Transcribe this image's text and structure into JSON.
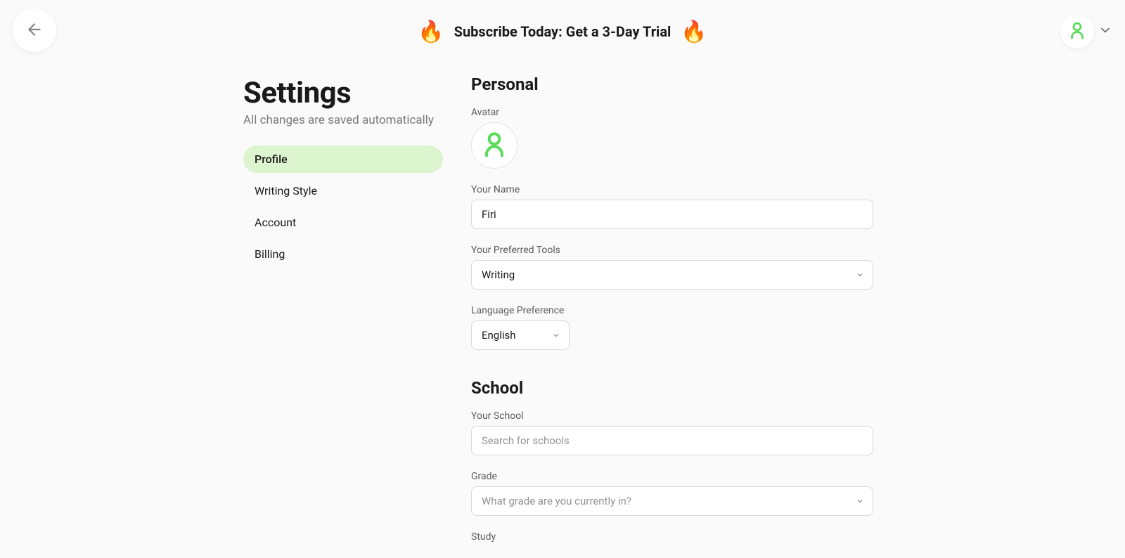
{
  "header": {
    "banner_text": "Subscribe Today: Get a 3-Day Trial",
    "fire_emoji": "🔥"
  },
  "page": {
    "title": "Settings",
    "subtitle": "All changes are saved automatically"
  },
  "nav": {
    "items": [
      {
        "label": "Profile",
        "active": true
      },
      {
        "label": "Writing Style",
        "active": false
      },
      {
        "label": "Account",
        "active": false
      },
      {
        "label": "Billing",
        "active": false
      }
    ]
  },
  "sections": {
    "personal": {
      "heading": "Personal",
      "avatar_label": "Avatar",
      "name_label": "Your Name",
      "name_value": "Firi",
      "tools_label": "Your Preferred Tools",
      "tools_value": "Writing",
      "language_label": "Language Preference",
      "language_value": "English"
    },
    "school": {
      "heading": "School",
      "school_label": "Your School",
      "school_placeholder": "Search for schools",
      "school_value": "",
      "grade_label": "Grade",
      "grade_placeholder": "What grade are you currently in?",
      "study_label": "Study"
    }
  }
}
